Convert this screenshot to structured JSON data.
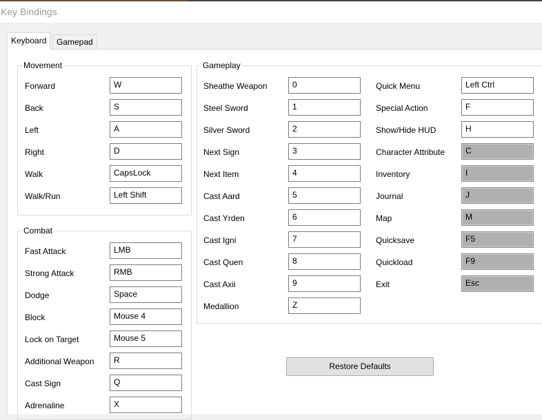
{
  "window": {
    "title": "Key Bindings"
  },
  "tabs": [
    {
      "label": "Keyboard",
      "active": true
    },
    {
      "label": "Gamepad",
      "active": false
    }
  ],
  "movement": {
    "title": "Movement",
    "bindings": [
      {
        "action": "Forward",
        "key": "W"
      },
      {
        "action": "Back",
        "key": "S"
      },
      {
        "action": "Left",
        "key": "A"
      },
      {
        "action": "Right",
        "key": "D"
      },
      {
        "action": "Walk",
        "key": "CapsLock"
      },
      {
        "action": "Walk/Run",
        "key": "Left Shift"
      }
    ]
  },
  "combat": {
    "title": "Combat",
    "bindings": [
      {
        "action": "Fast Attack",
        "key": "LMB"
      },
      {
        "action": "Strong Attack",
        "key": "RMB"
      },
      {
        "action": "Dodge",
        "key": "Space"
      },
      {
        "action": "Block",
        "key": "Mouse 4"
      },
      {
        "action": "Lock on Target",
        "key": "Mouse 5"
      },
      {
        "action": "Additional Weapon",
        "key": "R"
      },
      {
        "action": "Cast Sign",
        "key": "Q"
      },
      {
        "action": "Adrenaline",
        "key": "X"
      }
    ]
  },
  "gameplay": {
    "title": "Gameplay",
    "left": [
      {
        "action": "Sheathe Weapon",
        "key": "0"
      },
      {
        "action": "Steel Sword",
        "key": "1"
      },
      {
        "action": "Silver Sword",
        "key": "2"
      },
      {
        "action": "Next Sign",
        "key": "3"
      },
      {
        "action": "Next Item",
        "key": "4"
      },
      {
        "action": "Cast Aard",
        "key": "5"
      },
      {
        "action": "Cast Yrden",
        "key": "6"
      },
      {
        "action": "Cast Igni",
        "key": "7"
      },
      {
        "action": "Cast Quen",
        "key": "8"
      },
      {
        "action": "Cast Axii",
        "key": "9"
      },
      {
        "action": "Medallion",
        "key": "Z"
      }
    ],
    "right": [
      {
        "action": "Quick Menu",
        "key": "Left Ctrl",
        "disabled": false
      },
      {
        "action": "Special Action",
        "key": "F",
        "disabled": false
      },
      {
        "action": "Show/Hide HUD",
        "key": "H",
        "disabled": false
      },
      {
        "action": "Character Attribute",
        "key": "C",
        "disabled": true
      },
      {
        "action": "Inventory",
        "key": "I",
        "disabled": true
      },
      {
        "action": "Journal",
        "key": "J",
        "disabled": true
      },
      {
        "action": "Map",
        "key": "M",
        "disabled": true
      },
      {
        "action": "Quicksave",
        "key": "F5",
        "disabled": true
      },
      {
        "action": "Quickload",
        "key": "F9",
        "disabled": true
      },
      {
        "action": "Exit",
        "key": "Esc",
        "disabled": true
      }
    ]
  },
  "buttons": {
    "restore_defaults": "Restore Defaults"
  }
}
